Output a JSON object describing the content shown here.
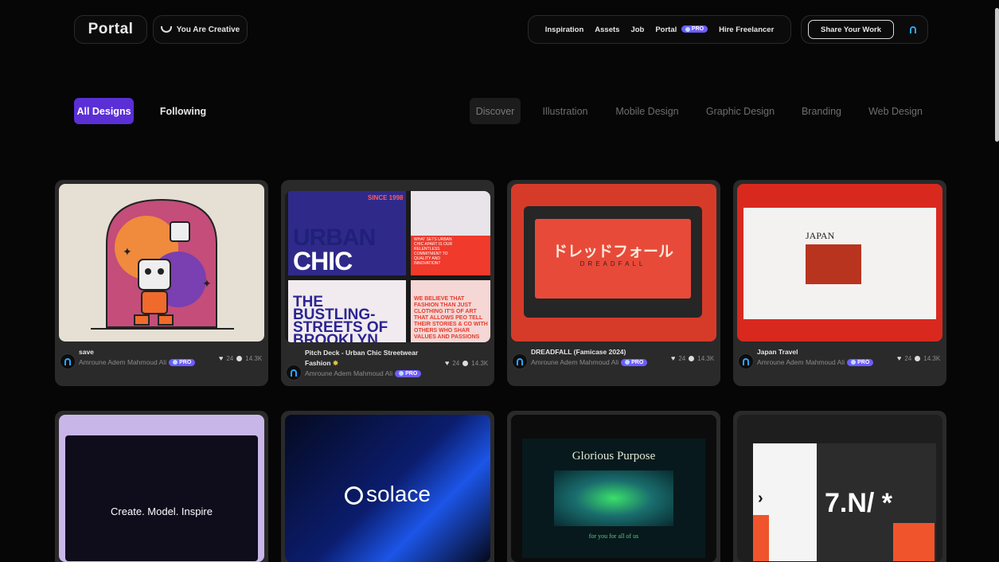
{
  "header": {
    "logo": "Portal",
    "creative_label": "You Are Creative",
    "nav": [
      "Inspiration",
      "Assets",
      "Job",
      "Portal",
      "Hire Freelancer"
    ],
    "pro_badge": "PRO",
    "share_label": "Share Your Work"
  },
  "filters": {
    "primary": [
      "All Designs",
      "Following"
    ],
    "categories": [
      "Discover",
      "Illustration",
      "Mobile Design",
      "Graphic Design",
      "Branding",
      "Web Design"
    ]
  },
  "cards": [
    {
      "title": "save",
      "author": "Amroune Adem Mahmoud Ali",
      "likes": "24",
      "views": "14.3K"
    },
    {
      "title": "Pitch Deck - Urban Chic Streetwear Fashion",
      "author": "Amroune Adem Mahmoud Ali",
      "likes": "24",
      "views": "14.3K"
    },
    {
      "title": "DREADFALL (Famicase 2024)",
      "author": "Amroune Adem Mahmoud Ali",
      "likes": "24",
      "views": "14.3K"
    },
    {
      "title": "Japan Travel",
      "author": "Amroune Adem Mahmoud Ali",
      "likes": "24",
      "views": "14.3K"
    }
  ],
  "thumb_text": {
    "urban": "URBAN",
    "chic": "CHIC",
    "bustling": "THE BUSTLING- STREETS OF BROOKLYN",
    "since": "SINCE 1998",
    "urban_chic_small": "URBAN CHIC",
    "fashion_quote": "WE BELIEVE THAT FASHION THAN JUST CLOTHING IT'S OF ART THAT ALLOWS PEO TELL THEIR STORIES & CO WITH OTHERS WHO SHAR VALUES AND PASSIONS",
    "what_sets": "WHAT SETS URBAN CHIC APART IS OUR RELENTLESS COMMITMENT TO QUALITY AND INNOVATION?",
    "dreadfall_jp": "ドレッドフォール",
    "dreadfall": "DREADFALL",
    "japan": "JAPAN",
    "create_model": "Create. Model. Inspire",
    "solace": "solace",
    "glorious": "Glorious Purpose",
    "for_you": "for you for all of us",
    "number": "7.N/ *"
  },
  "colors": {
    "accent": "#5a2fd6",
    "pro_badge": "#6f5cff",
    "avatar_icon": "#2aa6ff",
    "background": "#060606",
    "card": "#2a2a2a"
  }
}
